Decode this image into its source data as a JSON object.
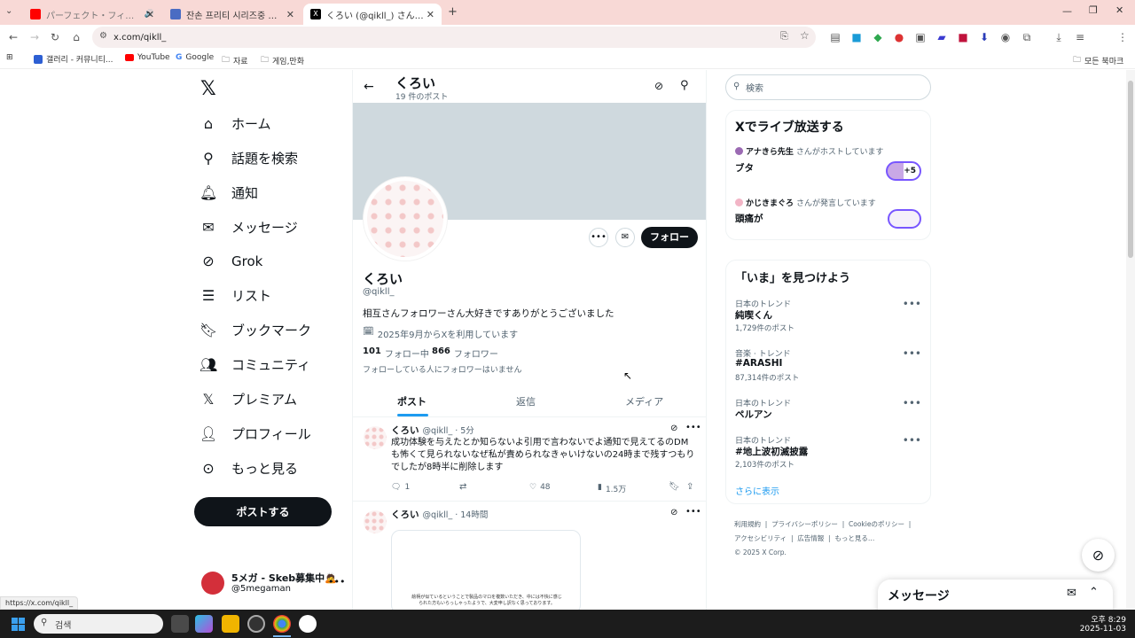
{
  "browser": {
    "tabs": [
      {
        "title": "パーフェクト・フィナーレ - YouTube",
        "active": false
      },
      {
        "title": "잔손 프리티 시리즈중 최고 명작",
        "active": false
      },
      {
        "title": "くろい (@qikll_) さん / X",
        "active": true
      }
    ],
    "url": "x.com/qikll_",
    "bookmarks": [
      "갤러리 - 커뮤니티...",
      "YouTube",
      "Google",
      "자료",
      "게임,만화"
    ],
    "all_bookmarks": "모든 북마크",
    "status_url": "https://x.com/qikll_"
  },
  "nav": {
    "items": [
      {
        "label": "ホーム",
        "icon": "home-icon"
      },
      {
        "label": "話題を検索",
        "icon": "search-icon"
      },
      {
        "label": "通知",
        "icon": "bell-icon"
      },
      {
        "label": "メッセージ",
        "icon": "mail-icon"
      },
      {
        "label": "Grok",
        "icon": "grok-icon"
      },
      {
        "label": "リスト",
        "icon": "list-icon"
      },
      {
        "label": "ブックマーク",
        "icon": "bookmark-icon"
      },
      {
        "label": "コミュニティ",
        "icon": "community-icon"
      },
      {
        "label": "プレミアム",
        "icon": "x-icon"
      },
      {
        "label": "プロフィール",
        "icon": "person-icon"
      },
      {
        "label": "もっと見る",
        "icon": "more-icon"
      }
    ],
    "post_button": "ポストする",
    "account": {
      "name": "5メガ - Skeb募集中🙇",
      "handle": "@5megaman"
    }
  },
  "profile": {
    "header_name": "くろい",
    "post_count": "19 件のポスト",
    "name": "くろい",
    "handle": "@qikll_",
    "bio": "相互さんフォロワーさん大好きですありがとうございました",
    "joined": "2025年9月からXを利用しています",
    "following_count": "101",
    "following_label": "フォロー中",
    "followers_count": "866",
    "followers_label": "フォロワー",
    "no_mutual": "フォローしている人にフォロワーはいません",
    "follow_button": "フォロー",
    "tabs": [
      "ポスト",
      "返信",
      "メディア"
    ]
  },
  "posts": [
    {
      "name": "くろい",
      "meta": "@qikll_ · 5分",
      "text": "成功体験を与えたとか知らないよ引用で言わないでよ通知で見えてるのDMも怖くて見られないなぜ私が責められなきゃいけないの24時まで残すつもりでしたが8時半に削除します",
      "replies": "1",
      "likes": "48",
      "views": "1.5万"
    },
    {
      "name": "くろい",
      "meta": "@qikll_ · 14時間",
      "image_text": "絵柄が似ているということで製品のマロを複数いただき、中には不快に感じられた方もいらっしゃったようで、大変申し訳なく思っております。"
    }
  ],
  "sidebar": {
    "search_placeholder": "検索",
    "live_title": "Xでライブ放送する",
    "live": [
      {
        "host": "アナきら先生",
        "suffix": "さんがホストしています",
        "title": "ブタ",
        "extra": "+5"
      },
      {
        "host": "かじきまぐろ",
        "suffix": "さんが発言しています",
        "title": "頭痛が"
      }
    ],
    "trends_title": "「いま」を見つけよう",
    "trends": [
      {
        "category": "日本のトレンド",
        "name": "純喫くん",
        "count": "1,729件のポスト"
      },
      {
        "category": "音楽 · トレンド",
        "name": "#ARASHI",
        "count": "87,314件のポスト"
      },
      {
        "category": "日本のトレンド",
        "name": "ペルアン",
        "count": ""
      },
      {
        "category": "日本のトレンド",
        "name": "#地上波初滅披露",
        "count": "2,103件のポスト"
      }
    ],
    "show_more": "さらに表示",
    "footer": [
      "利用規約",
      "プライバシーポリシー",
      "Cookieのポリシー",
      "アクセシビリティ",
      "広告情報",
      "もっと見る…",
      "© 2025 X Corp."
    ],
    "messages_title": "メッセージ"
  },
  "taskbar": {
    "search_placeholder": "검색",
    "time": "오후 8:29",
    "date": "2025-11-03"
  }
}
